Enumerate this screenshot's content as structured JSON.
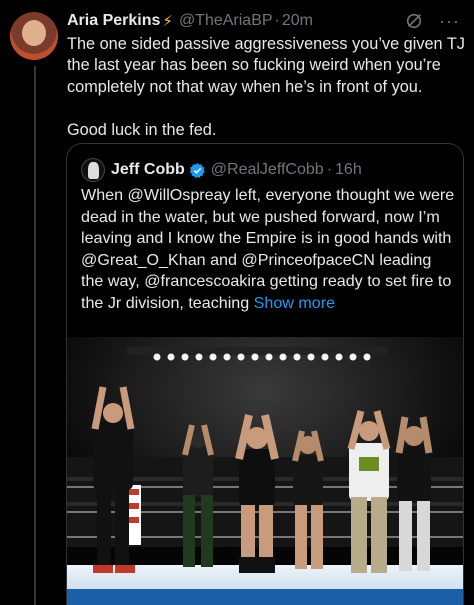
{
  "post": {
    "author_name": "Aria Perkins",
    "author_emoji": "⚡",
    "handle": "@TheAriaBP",
    "time": "20m",
    "text": "The one sided passive aggressiveness you’ve given TJ the last year has been so fucking weird when you’re completely not that way when he’s in front of you.\n\nGood luck in the fed."
  },
  "quote": {
    "author_name": "Jeff Cobb",
    "handle": "@RealJeffCobb",
    "time": "16h",
    "text": "When @WillOspreay left, everyone thought we were dead in the water, but we pushed forward, now I’m leaving and I know the Empire is in good hands with @Great_O_Khan and @PrinceofpaceCN leading the way, @francescoakira getting ready to set fire to the Jr division, teaching ",
    "show_more": "Show more"
  },
  "icons": {
    "author_badge": "lightning-bolt-icon",
    "grok": "grok-icon",
    "more": "more-icon",
    "verified": "verified-badge-icon"
  },
  "colors": {
    "background": "#000000",
    "text": "#e7e9ea",
    "secondary": "#71767b",
    "link": "#1d9bf0",
    "border": "#2f3336"
  }
}
